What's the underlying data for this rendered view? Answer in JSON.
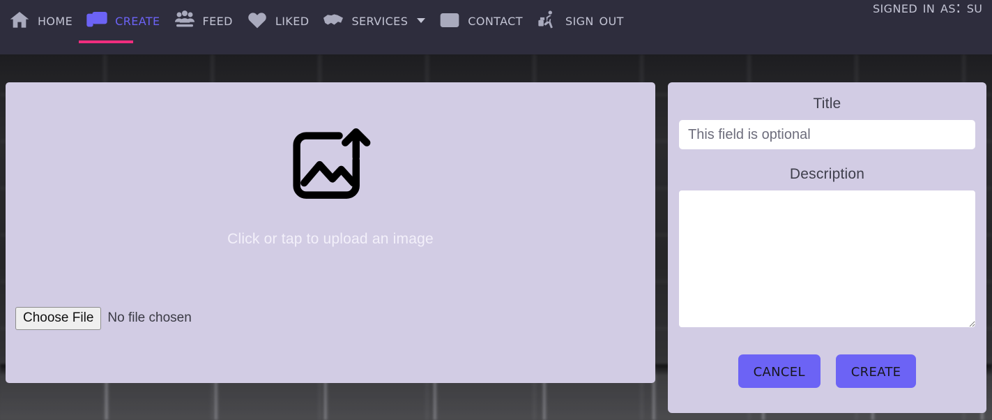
{
  "navbar": {
    "items": [
      {
        "label": "home",
        "icon": "home-icon",
        "active": false,
        "has_caret": false
      },
      {
        "label": "create",
        "icon": "images-icon",
        "active": true,
        "has_caret": false
      },
      {
        "label": "feed",
        "icon": "users-group-icon",
        "active": false,
        "has_caret": false
      },
      {
        "label": "liked",
        "icon": "heart-icon",
        "active": false,
        "has_caret": false
      },
      {
        "label": "services",
        "icon": "handshake-icon",
        "active": false,
        "has_caret": true
      },
      {
        "label": "contact",
        "icon": "id-card-icon",
        "active": false,
        "has_caret": false
      },
      {
        "label": "sign out",
        "icon": "walking-luggage-icon",
        "active": false,
        "has_caret": false
      }
    ],
    "signed_in_as": "signed in as: su",
    "background_color": "#2e2d3d",
    "active_color": "#6c63f5",
    "active_underline_color": "#ef2d7e",
    "label_color": "#c3c4d4"
  },
  "upload_panel": {
    "icon": "image-upload-icon",
    "dropzone_text": "Click or tap to upload an image",
    "choose_file_label": "Choose File",
    "no_file_chosen_label": "No file chosen",
    "background_color": "#d2cce4"
  },
  "form_panel": {
    "title_label": "Title",
    "title_placeholder": "This field is optional",
    "title_value": "",
    "description_label": "Description",
    "description_placeholder": "",
    "description_value": "",
    "cancel_label": "cancel",
    "create_label": "create",
    "button_color": "#6c63f5",
    "background_color": "#d2cce4"
  }
}
